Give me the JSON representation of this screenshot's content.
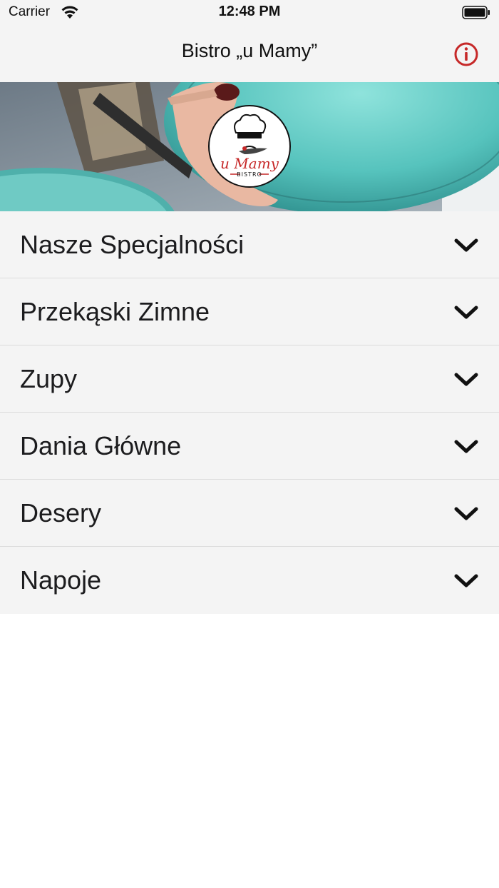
{
  "status_bar": {
    "carrier": "Carrier",
    "time": "12:48 PM",
    "wifi_icon": "wifi-icon",
    "battery_icon": "battery-icon"
  },
  "nav": {
    "title": "Bistro „u Mamy”",
    "info_icon": "info-icon",
    "accent_color": "#c62828"
  },
  "hero": {
    "image": "restaurant-plates-photo",
    "logo": {
      "top_text": "u Mamy",
      "bottom_text": "BISTRO",
      "icon": "chef-hat-icon"
    }
  },
  "menu": {
    "items": [
      {
        "label": "Nasze Specjalności",
        "icon": "chevron-down-icon"
      },
      {
        "label": "Przekąski Zimne",
        "icon": "chevron-down-icon"
      },
      {
        "label": "Zupy",
        "icon": "chevron-down-icon"
      },
      {
        "label": "Dania Główne",
        "icon": "chevron-down-icon"
      },
      {
        "label": "Desery",
        "icon": "chevron-down-icon"
      },
      {
        "label": "Napoje",
        "icon": "chevron-down-icon"
      }
    ]
  }
}
